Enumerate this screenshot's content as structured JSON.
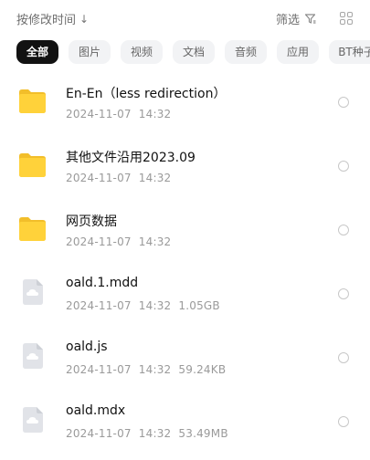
{
  "toolbar": {
    "sort_label": "按修改时间",
    "sort_arrow": "↓",
    "filter_label": "筛选"
  },
  "tabs": [
    {
      "label": "全部",
      "active": true
    },
    {
      "label": "图片"
    },
    {
      "label": "视频"
    },
    {
      "label": "文档"
    },
    {
      "label": "音频"
    },
    {
      "label": "应用"
    },
    {
      "label": "BT种子"
    }
  ],
  "files": [
    {
      "name": "En-En（less redirection）",
      "date": "2024-11-07",
      "time": "14:32",
      "size": "",
      "kind": "folder"
    },
    {
      "name": "其他文件沿用2023.09",
      "date": "2024-11-07",
      "time": "14:32",
      "size": "",
      "kind": "folder"
    },
    {
      "name": "网页数据",
      "date": "2024-11-07",
      "time": "14:32",
      "size": "",
      "kind": "folder"
    },
    {
      "name": "oald.1.mdd",
      "date": "2024-11-07",
      "time": "14:32",
      "size": "1.05GB",
      "kind": "file"
    },
    {
      "name": "oald.js",
      "date": "2024-11-07",
      "time": "14:32",
      "size": "59.24KB",
      "kind": "file"
    },
    {
      "name": "oald.mdx",
      "date": "2024-11-07",
      "time": "14:32",
      "size": "53.49MB",
      "kind": "file"
    }
  ],
  "colors": {
    "folder": "#FFD23A",
    "folder_tab": "#F2BE2A",
    "file_icon": "#E1E3E8",
    "cloud": "#ffffff",
    "active_tab_bg": "#121212"
  }
}
